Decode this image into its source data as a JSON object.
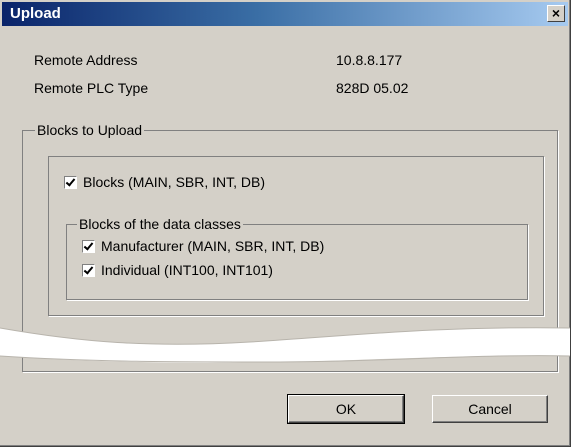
{
  "window": {
    "title": "Upload",
    "close_glyph": "×"
  },
  "fields": [
    {
      "label": "Remote Address",
      "value": "10.8.8.177"
    },
    {
      "label": "Remote PLC Type",
      "value": "828D 05.02"
    }
  ],
  "group_upload": {
    "legend": "Blocks to Upload"
  },
  "blocks_checkbox": {
    "label": "Blocks (MAIN, SBR, INT, DB)",
    "checked": true
  },
  "group_classes": {
    "legend": "Blocks of the data classes"
  },
  "manufacturer_checkbox": {
    "label": "Manufacturer (MAIN, SBR, INT, DB)",
    "checked": true
  },
  "individual_checkbox": {
    "label": "Individual (INT100, INT101)",
    "checked": true
  },
  "buttons": {
    "ok": "OK",
    "cancel": "Cancel"
  }
}
